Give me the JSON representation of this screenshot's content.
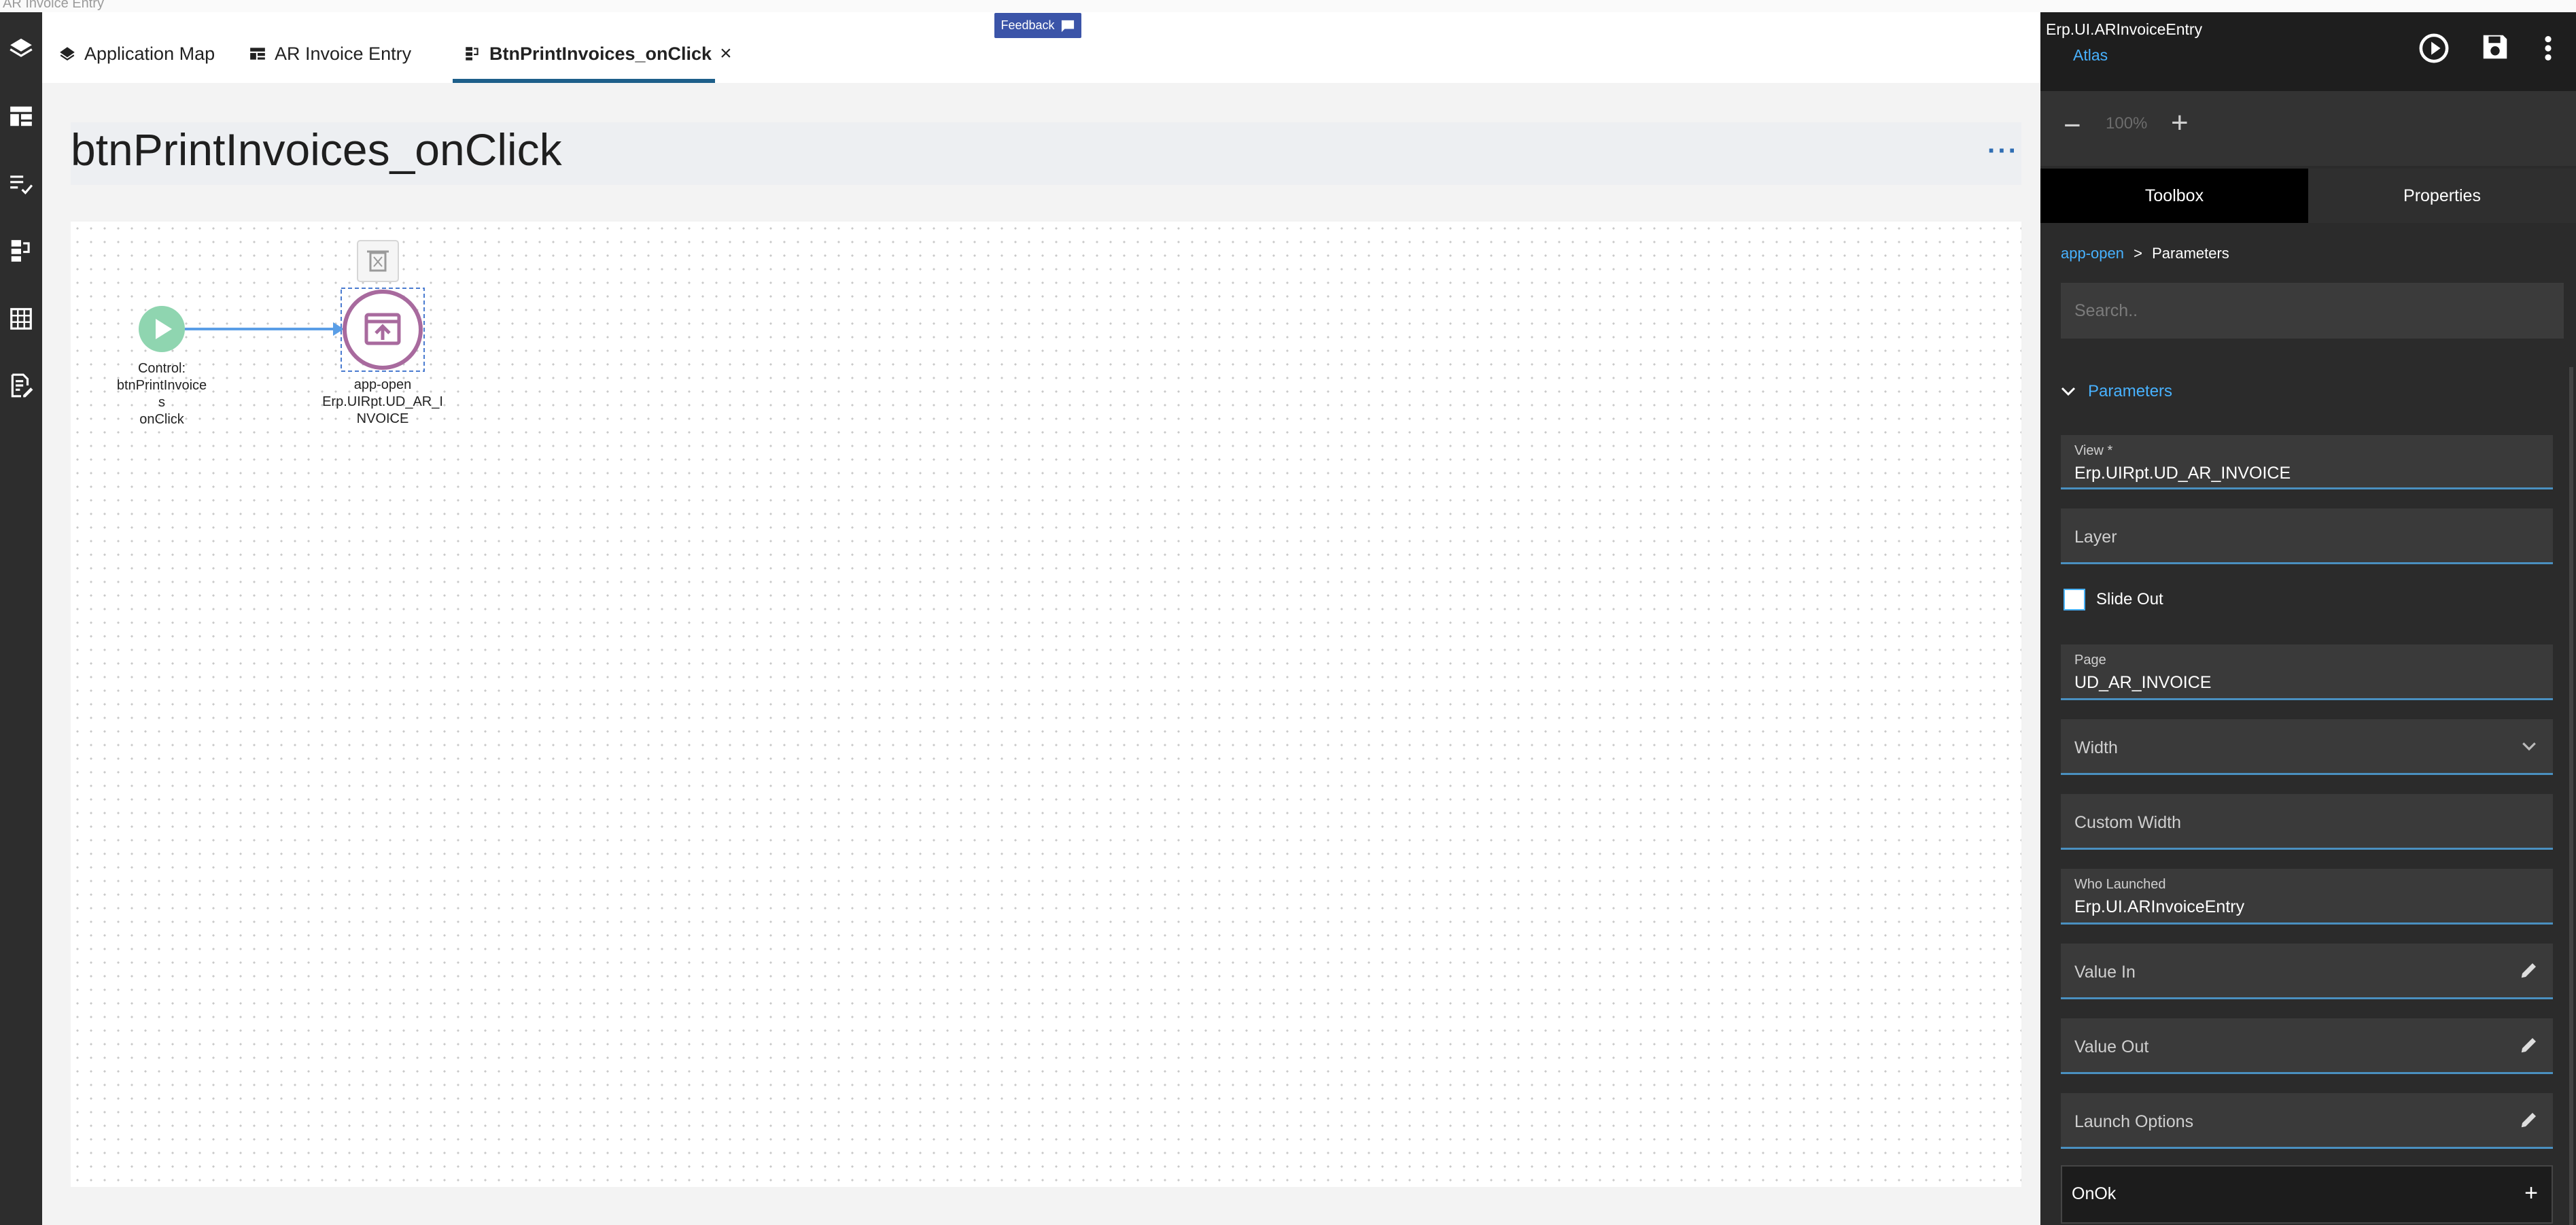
{
  "window": {
    "title": "AR Invoice Entry"
  },
  "feedback": {
    "label": "Feedback"
  },
  "tabs": [
    {
      "label": "Application Map",
      "icon": "layers-icon"
    },
    {
      "label": "AR Invoice Entry",
      "icon": "table-icon"
    },
    {
      "label": "BtnPrintInvoices_onClick",
      "icon": "flow-icon",
      "close": "×"
    }
  ],
  "page": {
    "title": "btnPrintInvoices_onClick",
    "more": "···"
  },
  "flow": {
    "start_node": {
      "lines": [
        "Control:",
        "btnPrintInvoice",
        "s",
        "onClick"
      ]
    },
    "action_node": {
      "lines": [
        "app-open",
        "Erp.UIRpt.UD_AR_I",
        "NVOICE"
      ]
    }
  },
  "panel": {
    "app_name": "Erp.UI.ARInvoiceEntry",
    "layer": "Atlas",
    "zoom": {
      "minus": "−",
      "value": "100%",
      "plus": "+"
    },
    "tabs": {
      "toolbox": "Toolbox",
      "properties": "Properties"
    },
    "breadcrumb": {
      "link": "app-open",
      "sep": ">",
      "current": "Parameters"
    },
    "search_placeholder": "Search..",
    "section_title": "Parameters",
    "fields": {
      "view": {
        "label": "View *",
        "value": "Erp.UIRpt.UD_AR_INVOICE"
      },
      "layer": {
        "placeholder": "Layer"
      },
      "slide_out": {
        "label": "Slide Out",
        "checked": false
      },
      "page": {
        "label": "Page",
        "value": "UD_AR_INVOICE"
      },
      "width": {
        "placeholder": "Width"
      },
      "custom_width": {
        "placeholder": "Custom Width"
      },
      "who_launched": {
        "label": "Who Launched",
        "value": "Erp.UI.ARInvoiceEntry"
      },
      "value_in": {
        "placeholder": "Value In"
      },
      "value_out": {
        "placeholder": "Value Out"
      },
      "launch_options": {
        "placeholder": "Launch Options"
      }
    },
    "onok": {
      "label": "OnOk",
      "add": "+"
    }
  },
  "colors": {
    "accent": "#48b2ff",
    "start_node": "#8fd5b0",
    "action_node": "#a86a9e",
    "tab_active": "#1d5f8a"
  }
}
